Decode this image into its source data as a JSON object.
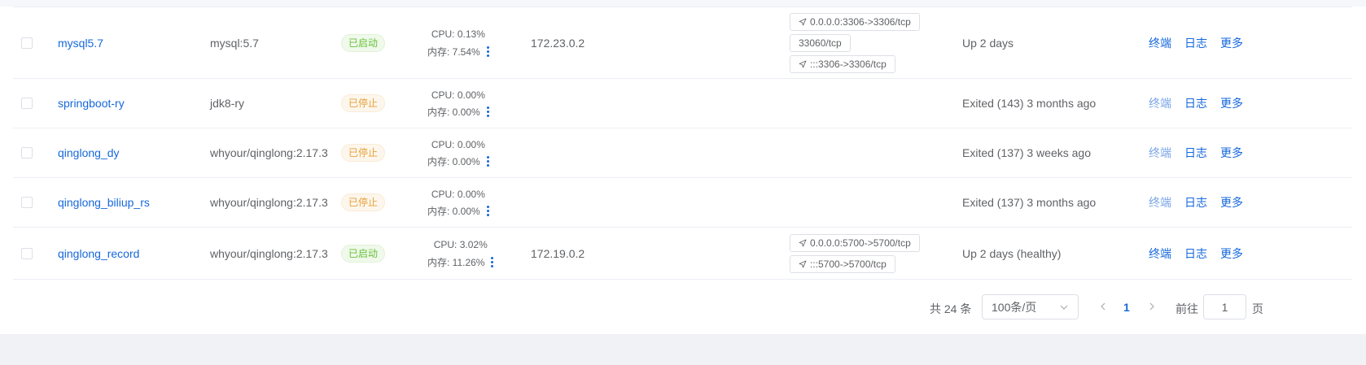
{
  "containers": [
    {
      "name": "mysql5.7",
      "image": "mysql:5.7",
      "state": "已启动",
      "state_kind": "running",
      "cpu": "CPU: 0.13%",
      "mem": "内存: 7.54%",
      "ip": "172.23.0.2",
      "ports": [
        {
          "text": "0.0.0.0:3306->3306/tcp",
          "icon": "send-icon"
        },
        {
          "text": "33060/tcp",
          "icon": ""
        },
        {
          "text": ":::3306->3306/tcp",
          "icon": "send-icon"
        }
      ],
      "status": "Up 2 days",
      "ops": {
        "terminal": "终端",
        "logs": "日志",
        "more": "更多"
      },
      "terminal_enabled": true
    },
    {
      "name": "springboot-ry",
      "image": "jdk8-ry",
      "state": "已停止",
      "state_kind": "stopped",
      "cpu": "CPU: 0.00%",
      "mem": "内存: 0.00%",
      "ip": "",
      "ports": [],
      "status": "Exited (143) 3 months ago",
      "ops": {
        "terminal": "终端",
        "logs": "日志",
        "more": "更多"
      },
      "terminal_enabled": false
    },
    {
      "name": "qinglong_dy",
      "image": "whyour/qinglong:2.17.3",
      "state": "已停止",
      "state_kind": "stopped",
      "cpu": "CPU: 0.00%",
      "mem": "内存: 0.00%",
      "ip": "",
      "ports": [],
      "status": "Exited (137) 3 weeks ago",
      "ops": {
        "terminal": "终端",
        "logs": "日志",
        "more": "更多"
      },
      "terminal_enabled": false
    },
    {
      "name": "qinglong_biliup_rs",
      "image": "whyour/qinglong:2.17.3",
      "state": "已停止",
      "state_kind": "stopped",
      "cpu": "CPU: 0.00%",
      "mem": "内存: 0.00%",
      "ip": "",
      "ports": [],
      "status": "Exited (137) 3 months ago",
      "ops": {
        "terminal": "终端",
        "logs": "日志",
        "more": "更多"
      },
      "terminal_enabled": false
    },
    {
      "name": "qinglong_record",
      "image": "whyour/qinglong:2.17.3",
      "state": "已启动",
      "state_kind": "running",
      "cpu": "CPU: 3.02%",
      "mem": "内存: 11.26%",
      "ip": "172.19.0.2",
      "ports": [
        {
          "text": "0.0.0.0:5700->5700/tcp",
          "icon": "send-icon"
        },
        {
          "text": ":::5700->5700/tcp",
          "icon": "send-icon"
        }
      ],
      "status": "Up 2 days (healthy)",
      "ops": {
        "terminal": "终端",
        "logs": "日志",
        "more": "更多"
      },
      "terminal_enabled": true
    }
  ],
  "pagination": {
    "total": "共 24 条",
    "page_size": "100条/页",
    "current_page": "1",
    "goto_label": "前往",
    "goto_value": "1",
    "page_suffix": "页"
  },
  "colors": {
    "link": "#1668dc",
    "running": "#67c23a",
    "stopped": "#e6a23c"
  }
}
